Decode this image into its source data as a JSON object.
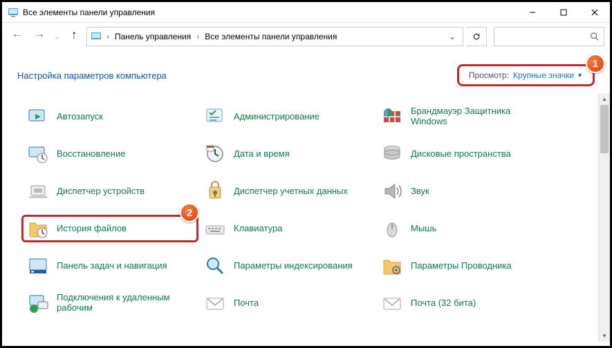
{
  "window": {
    "title": "Все элементы панели управления"
  },
  "breadcrumb": {
    "seg1": "Панель управления",
    "seg2": "Все элементы панели управления"
  },
  "header": {
    "title": "Настройка параметров компьютера",
    "view_label": "Просмотр:",
    "view_value": "Крупные значки"
  },
  "markers": {
    "m1": "1",
    "m2": "2"
  },
  "items": [
    {
      "label": "Автозапуск"
    },
    {
      "label": "Администрирование"
    },
    {
      "label": "Брандмауэр Защитника Windows"
    },
    {
      "label": "Восстановление"
    },
    {
      "label": "Дата и время"
    },
    {
      "label": "Дисковые пространства"
    },
    {
      "label": "Диспетчер устройств"
    },
    {
      "label": "Диспетчер учетных данных"
    },
    {
      "label": "Звук"
    },
    {
      "label": "История файлов"
    },
    {
      "label": "Клавиатура"
    },
    {
      "label": "Мышь"
    },
    {
      "label": "Панель задач и навигация"
    },
    {
      "label": "Параметры индексирования"
    },
    {
      "label": "Параметры Проводника"
    },
    {
      "label": "Подключения к удаленным рабочим"
    },
    {
      "label": "Почта"
    },
    {
      "label": "Почта (32 бита)"
    }
  ]
}
